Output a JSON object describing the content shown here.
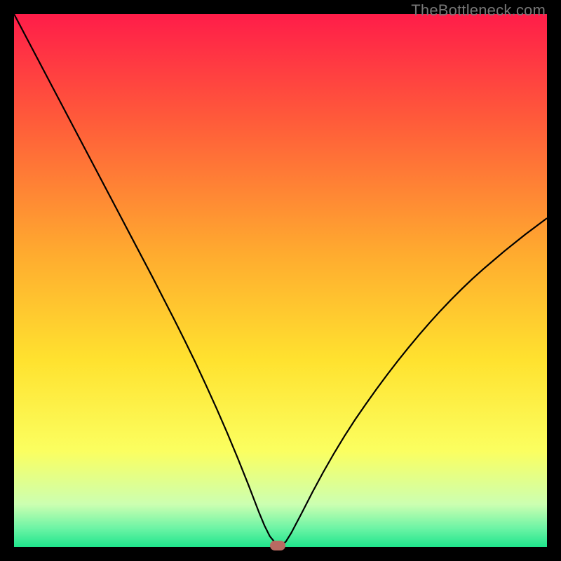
{
  "watermark": "TheBottleneck.com",
  "chart_data": {
    "type": "line",
    "title": "",
    "xlabel": "",
    "ylabel": "",
    "xlim": [
      0,
      100
    ],
    "ylim": [
      0,
      100
    ],
    "grid": false,
    "legend": false,
    "background_gradient_stops": [
      {
        "offset": 0.0,
        "color": "#ff1d49"
      },
      {
        "offset": 0.2,
        "color": "#ff5b3a"
      },
      {
        "offset": 0.45,
        "color": "#ffab2f"
      },
      {
        "offset": 0.65,
        "color": "#ffe22f"
      },
      {
        "offset": 0.82,
        "color": "#fbff60"
      },
      {
        "offset": 0.92,
        "color": "#ccffb1"
      },
      {
        "offset": 0.965,
        "color": "#6cf4a5"
      },
      {
        "offset": 1.0,
        "color": "#1fe58c"
      }
    ],
    "series": [
      {
        "name": "bottleneck-curve",
        "stroke": "#000000",
        "stroke_width": 2.2,
        "x": [
          0,
          2,
          4,
          6,
          8,
          10,
          12,
          14,
          16,
          18,
          20,
          22,
          24,
          26,
          28,
          30,
          32,
          34,
          36,
          38,
          40,
          42,
          44,
          46,
          47,
          48,
          49,
          50,
          51,
          52,
          54,
          56,
          58,
          60,
          62,
          64,
          66,
          68,
          70,
          72,
          74,
          76,
          78,
          80,
          82,
          84,
          86,
          88,
          90,
          92,
          94,
          96,
          98,
          100
        ],
        "y": [
          100,
          96.2,
          92.4,
          88.6,
          84.8,
          81.0,
          77.2,
          73.4,
          69.6,
          65.8,
          62.0,
          58.2,
          54.4,
          50.6,
          46.7,
          42.8,
          38.8,
          34.7,
          30.4,
          26.0,
          21.4,
          16.6,
          11.6,
          6.4,
          4.0,
          2.0,
          0.8,
          0.2,
          1.0,
          2.6,
          6.4,
          10.3,
          14.0,
          17.5,
          20.8,
          23.9,
          26.8,
          29.6,
          32.3,
          34.9,
          37.4,
          39.8,
          42.1,
          44.3,
          46.4,
          48.4,
          50.3,
          52.1,
          53.8,
          55.5,
          57.1,
          58.7,
          60.2,
          61.7
        ]
      }
    ],
    "marker": {
      "x": 49.5,
      "y": 0.2,
      "color": "#b96a62"
    }
  }
}
